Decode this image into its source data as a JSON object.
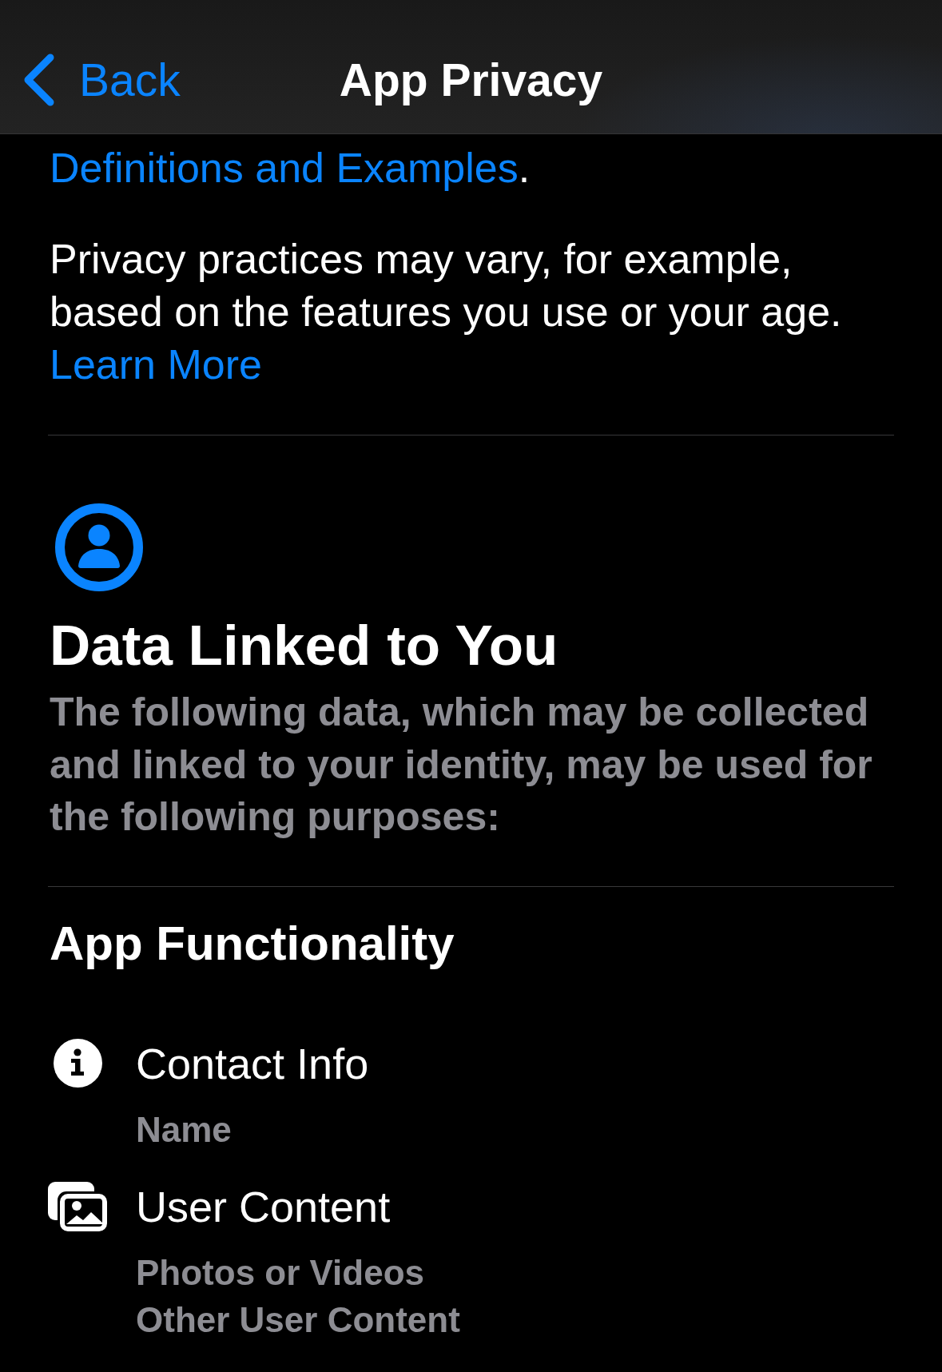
{
  "nav_bar": {
    "back": "Back",
    "title": "App Privacy"
  },
  "definitions_note": {
    "link": "Definitions and Examples",
    "text_after": "."
  },
  "privacy_note": {
    "text": "Privacy practices may vary, for example, based on the features you use or your age.",
    "link": "Learn More"
  },
  "sections": [
    {
      "kind": "linked",
      "title": "Data Linked to You",
      "description": "The following data, which may be collected and linked to your identity, may be used for the following purposes:",
      "categories": [
        {
          "title": "App Functionality",
          "items": [
            {
              "kind": "contact",
              "label": "Contact Info",
              "details": [
                "Name"
              ]
            },
            {
              "kind": "content",
              "label": "User Content",
              "details": [
                "Photos or Videos",
                "Other User Content"
              ]
            }
          ]
        }
      ]
    }
  ]
}
